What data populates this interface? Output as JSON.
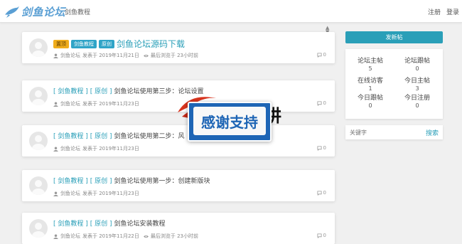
{
  "header": {
    "logo_text": "剑鱼论坛",
    "nav_link": "剑鱼教程",
    "register": "注册",
    "login": "登录"
  },
  "posts": [
    {
      "badges": [
        "置顶",
        "剑鱼教程",
        "原创"
      ],
      "title": "剑鱼论坛源码下载",
      "author": "剑鱼论坛",
      "published": "发表于 2019年11月21日",
      "last_view": "最后浏览于 23小时前",
      "replies": "0"
    },
    {
      "tag_category": "[ 剑鱼教程 ]",
      "tag_original": "[ 原创 ]",
      "title": "剑鱼论坛使用第三步：论坛设置",
      "author": "剑鱼论坛",
      "published": "发表于 2019年11月23日",
      "replies": "0"
    },
    {
      "tag_category": "[ 剑鱼教程 ]",
      "tag_original": "[ 原创 ]",
      "title": "剑鱼论坛使用第二步：风",
      "author": "剑鱼论坛",
      "published": "发表于 2019年11月23日",
      "replies": "0"
    },
    {
      "tag_category": "[ 剑鱼教程 ]",
      "tag_original": "[ 原创 ]",
      "title": "剑鱼论坛使用第一步：创建新版块",
      "author": "剑鱼论坛",
      "published": "发表于 2019年11月23日",
      "replies": "0"
    },
    {
      "tag_category": "[ 剑鱼教程 ]",
      "tag_original": "[ 原创 ]",
      "title": "剑鱼论坛安装教程",
      "author": "剑鱼论坛",
      "published": "发表于 2019年11月22日",
      "last_view": "最后浏览于 23小时前",
      "replies": "0"
    }
  ],
  "sidebar": {
    "new_post_button": "发新帖",
    "stats": [
      {
        "label": "论坛主帖",
        "value": "5"
      },
      {
        "label": "论坛跟帖",
        "value": "0"
      },
      {
        "label": "在线访客",
        "value": "1"
      },
      {
        "label": "今日主帖",
        "value": "3"
      },
      {
        "label": "今日跟帖",
        "value": "0"
      },
      {
        "label": "今日注册",
        "value": "0"
      }
    ],
    "search_placeholder": "关键字",
    "search_button": "搜索"
  },
  "overlay": {
    "banner_text": "感谢支持",
    "partial_black": "讲",
    "partial_sub": "m"
  },
  "colors": {
    "accent": "#2a9fb8",
    "top_badge": "#f0ad1c",
    "banner_blue": "#1e65b5"
  }
}
